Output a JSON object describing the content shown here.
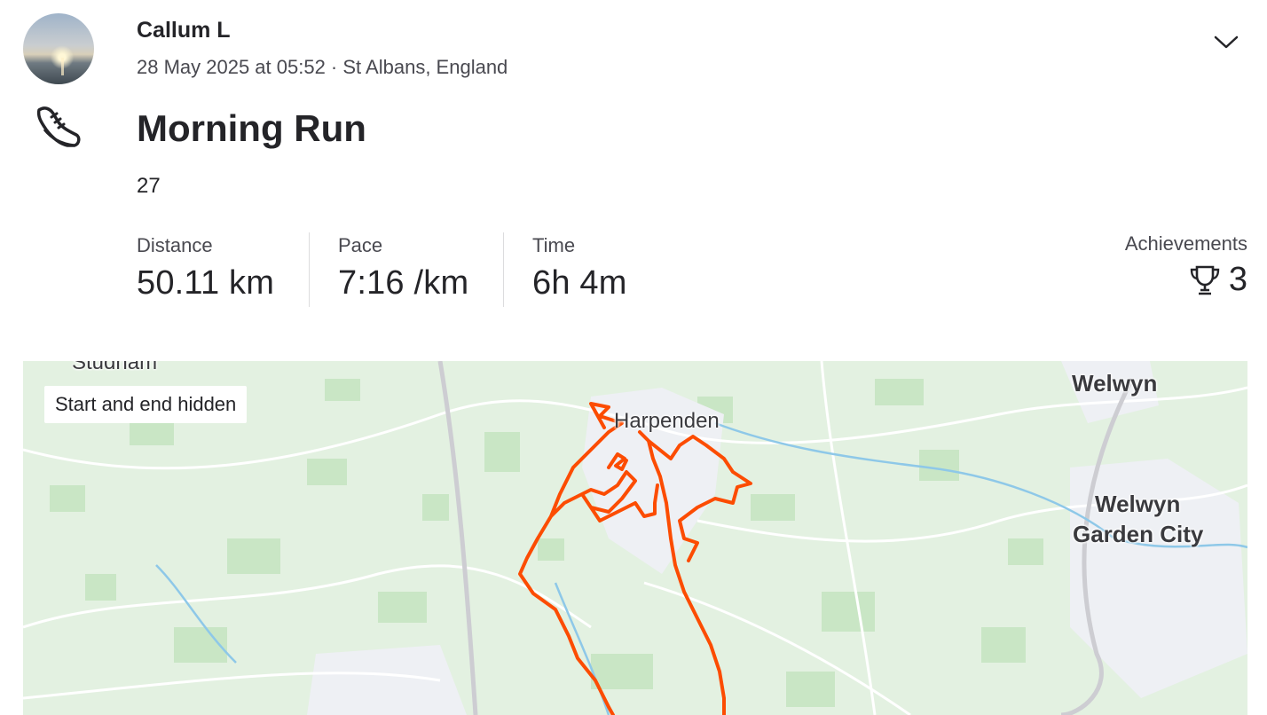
{
  "header": {
    "athlete_name": "Callum L",
    "date_location": "28 May 2025 at 05:52 · St Albans, England",
    "menu_icon": "chevron-down-icon"
  },
  "activity": {
    "type_icon": "running-shoe-icon",
    "title": "Morning Run",
    "description": "27"
  },
  "stats": [
    {
      "label": "Distance",
      "value": "50.11 km"
    },
    {
      "label": "Pace",
      "value": "7:16 /km"
    },
    {
      "label": "Time",
      "value": "6h 4m"
    }
  ],
  "achievements": {
    "label": "Achievements",
    "icon": "trophy-icon",
    "count": "3"
  },
  "map": {
    "privacy_badge": "Start and end hidden",
    "place_labels": {
      "studham": "Studham",
      "harpenden": "Harpenden",
      "welwyn": "Welwyn",
      "welwyn_garden_city_1": "Welwyn",
      "welwyn_garden_city_2": "Garden City"
    },
    "route_color": "#fc4c02",
    "land_color": "#e3f1e1",
    "river_color": "#8ec8e8"
  }
}
